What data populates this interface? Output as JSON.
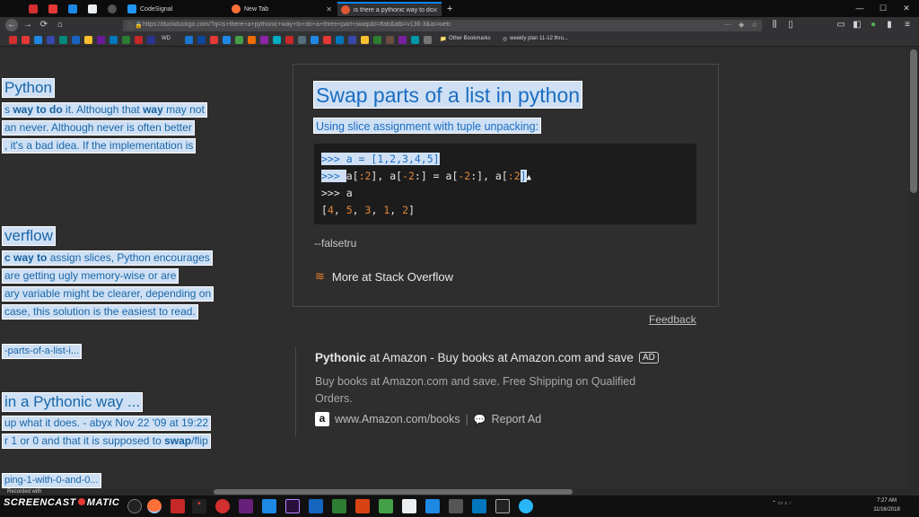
{
  "tabs": [
    {
      "label": "",
      "color": "#d32f2f"
    },
    {
      "label": "",
      "color": "#d32f2f"
    },
    {
      "label": "",
      "color": "#1e88e5"
    },
    {
      "label": "",
      "color": "#555"
    },
    {
      "label": "CodeSignal",
      "color": "#2196f3"
    },
    {
      "label": "New Tab",
      "color": "#ff7139"
    },
    {
      "label": "is there a pythonic way to do a...",
      "color": "#de5833"
    }
  ],
  "new_tab_symbol": "+",
  "window_controls": {
    "min": "—",
    "max": "☐",
    "close": "✕"
  },
  "url": "https://duckduckgo.com/?q=is+there+a+pythonic+way+to+do+a+three+part+swap&t=ffab&atb=v136-3&ia=web",
  "url_domain": "duckduckgo.com",
  "bookmarks": {
    "wd_label": "WD",
    "other_bookmarks": "Other Bookmarks",
    "weekly_plan": "weekly plan 11-12 thru..."
  },
  "left_results": {
    "h1": "Python",
    "p1a_pre": "s ",
    "p1a_bold": "way to do",
    "p1a_mid": " it. Although that ",
    "p1a_bold2": "way",
    "p1a_post": " may not",
    "p1b": "an never. Although never is often better",
    "p1c": ", it's a bad idea. If the implementation is",
    "h2": "verflow",
    "p2a_bold": "c way to",
    "p2a_post": " assign slices, Python encourages",
    "p2b": "are getting ugly memory-wise or are",
    "p2c": "ary variable might be clearer, depending on",
    "p2d": "case, this solution is the easiest to read.",
    "link2": "-parts-of-a-list-i...",
    "h3": " in a Pythonic way ...",
    "p3a": " up what it does. - abyx Nov 22 '09 at 19:22",
    "p3b_pre": "r 1 or 0 and that it is supposed to ",
    "p3b_bold": "swap",
    "p3b_post": "/flip",
    "link3": "ping-1-with-0-and-0..."
  },
  "answer": {
    "title": "Swap parts of a list in python",
    "subtitle": "Using slice assignment with tuple unpacking:",
    "code_prompt": ">>> ",
    "code_line1": "a = [1,2,3,4,5]",
    "code_line2_a": "a[",
    "code_line2_b": ":2",
    "code_line2_c": "], a[",
    "code_line2_d": "-2",
    "code_line2_e": ":] = a[",
    "code_line2_f": "-2",
    "code_line2_g": ":], a[",
    "code_line2_h": ":2",
    "code_line2_i": "]",
    "code_line3": "a",
    "code_line4_open": "[",
    "code_line4_values": [
      "4",
      "5",
      "3",
      "1",
      "2"
    ],
    "code_line4_close": "]",
    "attribution": "--falsetru",
    "more_link": "More at Stack Overflow"
  },
  "feedback": "Feedback",
  "ad": {
    "title_bold": "Pythonic",
    "title_rest": " at Amazon - Buy books at Amazon.com and save",
    "badge": "AD",
    "description": "Buy books at Amazon.com and save. Free Shipping on Qualified Orders.",
    "domain_link": "www.Amazon.com/books",
    "report": "Report Ad"
  },
  "watermark": "SCREENCAST",
  "watermark2": "MATIC",
  "watermark_sub": "Recorded with",
  "clock": {
    "time": "7:27 AM",
    "date": "11/16/2018"
  },
  "colors": {
    "highlight_bg": "#cfe0f4",
    "link_blue": "#1b6dc1",
    "accent": "#0a84ff"
  }
}
